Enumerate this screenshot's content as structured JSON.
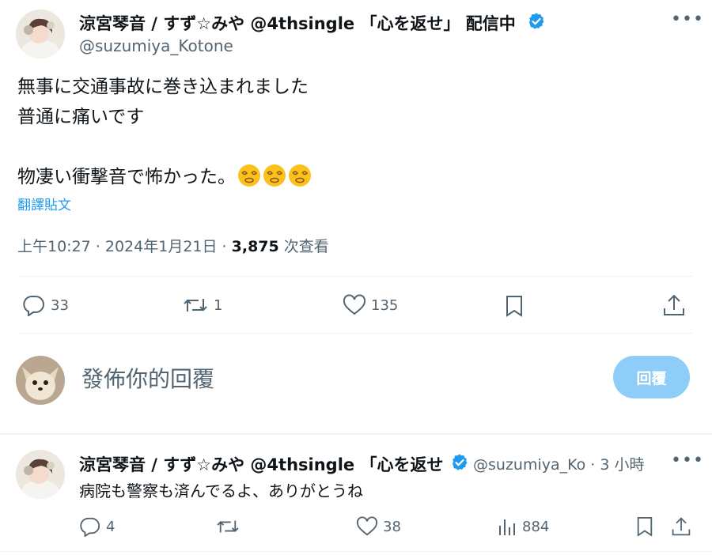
{
  "tweet": {
    "display_name": "涼宮琴音 / すず☆みや @4thsingle 「心を返せ」 配信中",
    "handle": "@suzumiya_Kotone",
    "lines": [
      "無事に交通事故に巻き込まれました",
      "普通に痛いです",
      "",
      "物凄い衝撃音で怖かった。"
    ],
    "emoji": [
      "dizzy-face-emoji",
      "dizzy-face-emoji",
      "dizzy-face-emoji"
    ],
    "translate_label": "翻譯貼文",
    "timestamp": "上午10:27 · 2024年1月21日 · ",
    "views_count": "3,875",
    "views_label": " 次查看",
    "actions": {
      "reply_count": "33",
      "retweet_count": "1",
      "like_count": "135"
    }
  },
  "composer": {
    "placeholder": "發佈你的回覆",
    "reply_button": "回覆"
  },
  "reply": {
    "display_name": "涼宮琴音 / すず☆みや @4thsingle 「心を返せ",
    "handle_time": "@suzumiya_Ko · 3 小時",
    "text": "病院も警察も済んでるよ、ありがとうね",
    "actions": {
      "reply_count": "4",
      "retweet_count": "",
      "like_count": "38",
      "views_count": "884"
    }
  },
  "colors": {
    "accent": "#1d9bf0",
    "verified": "#1d9bf0",
    "reply_button_disabled": "#8ecdf8",
    "muted": "#536471"
  }
}
